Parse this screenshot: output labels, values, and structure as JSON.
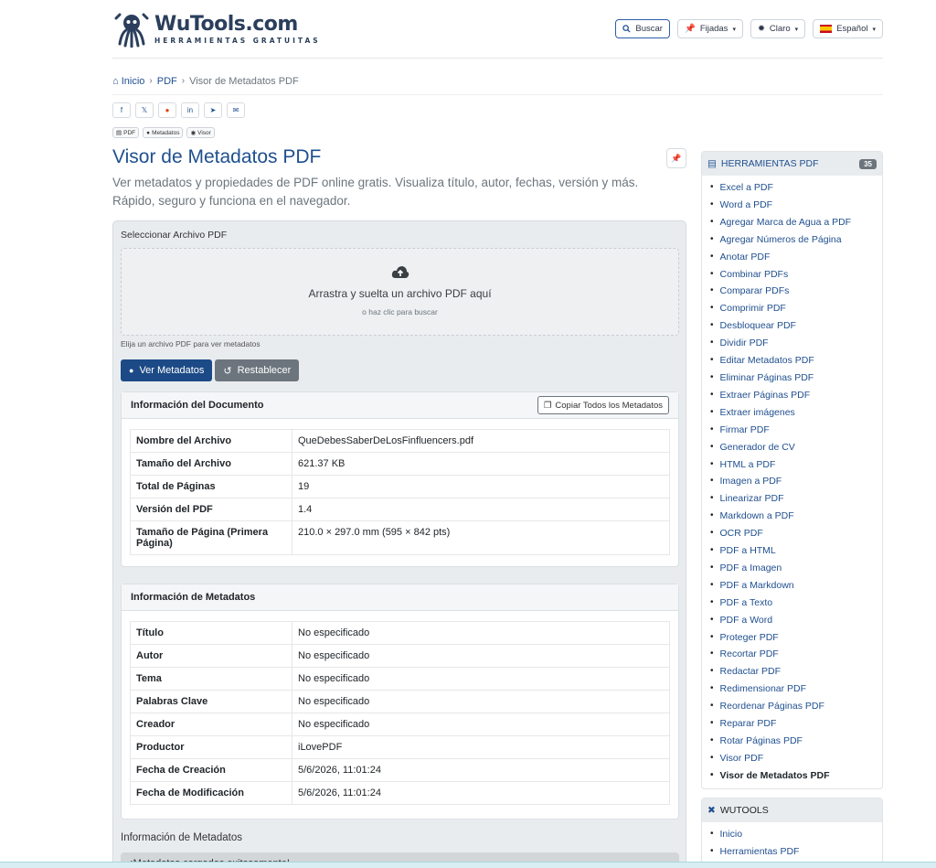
{
  "header": {
    "brand": "WuTools.com",
    "tagline": "HERRAMIENTAS GRATUITAS",
    "search_label": "Buscar",
    "pinned_label": "Fijadas",
    "theme_label": "Claro",
    "language_label": "Español"
  },
  "breadcrumb": {
    "home": "Inicio",
    "section": "PDF",
    "current": "Visor de Metadatos PDF"
  },
  "tags": [
    "PDF",
    "Metadatos",
    "Visor"
  ],
  "page": {
    "title": "Visor de Metadatos PDF",
    "description": "Ver metadatos y propiedades de PDF online gratis. Visualiza título, autor, fechas, versión y más. Rápido, seguro y funciona en el navegador."
  },
  "upload": {
    "label": "Seleccionar Archivo PDF",
    "drop_text": "Arrastra y suelta un archivo PDF aquí",
    "click_text": "o haz clic para buscar",
    "hint": "Elija un archivo PDF para ver metadatos",
    "view_button": "Ver Metadatos",
    "reset_button": "Restablecer"
  },
  "document_info": {
    "title": "Información del Documento",
    "copy_button": "Copiar Todos los Metadatos",
    "rows": [
      {
        "key": "Nombre del Archivo",
        "value": "QueDebesSaberDeLosFinfluencers.pdf"
      },
      {
        "key": "Tamaño del Archivo",
        "value": "621.37 KB"
      },
      {
        "key": "Total de Páginas",
        "value": "19"
      },
      {
        "key": "Versión del PDF",
        "value": "1.4"
      },
      {
        "key": "Tamaño de Página (Primera Página)",
        "value": "210.0 × 297.0 mm (595 × 842 pts)"
      }
    ]
  },
  "metadata_info": {
    "title": "Información de Metadatos",
    "rows": [
      {
        "key": "Título",
        "value": "No especificado"
      },
      {
        "key": "Autor",
        "value": "No especificado"
      },
      {
        "key": "Tema",
        "value": "No especificado"
      },
      {
        "key": "Palabras Clave",
        "value": "No especificado"
      },
      {
        "key": "Creador",
        "value": "No especificado"
      },
      {
        "key": "Productor",
        "value": "iLovePDF"
      },
      {
        "key": "Fecha de Creación",
        "value": "5/6/2026, 11:01:24"
      },
      {
        "key": "Fecha de Modificación",
        "value": "5/6/2026, 11:01:24"
      }
    ]
  },
  "result": {
    "label": "Información de Metadatos",
    "alert": "¡Metadatos cargados exitosamente!"
  },
  "sidebar": {
    "pdf_tools_title": "HERRAMIENTAS PDF",
    "pdf_tools_count": "35",
    "pdf_tools": [
      "Excel a PDF",
      "Word a PDF",
      "Agregar Marca de Agua a PDF",
      "Agregar Números de Página",
      "Anotar PDF",
      "Combinar PDFs",
      "Comparar PDFs",
      "Comprimir PDF",
      "Desbloquear PDF",
      "Dividir PDF",
      "Editar Metadatos PDF",
      "Eliminar Páginas PDF",
      "Extraer Páginas PDF",
      "Extraer imágenes",
      "Firmar PDF",
      "Generador de CV",
      "HTML a PDF",
      "Imagen a PDF",
      "Linearizar PDF",
      "Markdown a PDF",
      "OCR PDF",
      "PDF a HTML",
      "PDF a Imagen",
      "PDF a Markdown",
      "PDF a Texto",
      "PDF a Word",
      "Proteger PDF",
      "Recortar PDF",
      "Redactar PDF",
      "Redimensionar PDF",
      "Reordenar Páginas PDF",
      "Reparar PDF",
      "Rotar Páginas PDF",
      "Visor PDF",
      "Visor de Metadatos PDF"
    ],
    "wutools_title": "WUTOOLS",
    "wutools_links": [
      "Inicio",
      "Herramientas PDF"
    ]
  },
  "colors": {
    "primary": "#1c4a86",
    "link": "#1f4f8f",
    "secondary": "#6c757d"
  }
}
